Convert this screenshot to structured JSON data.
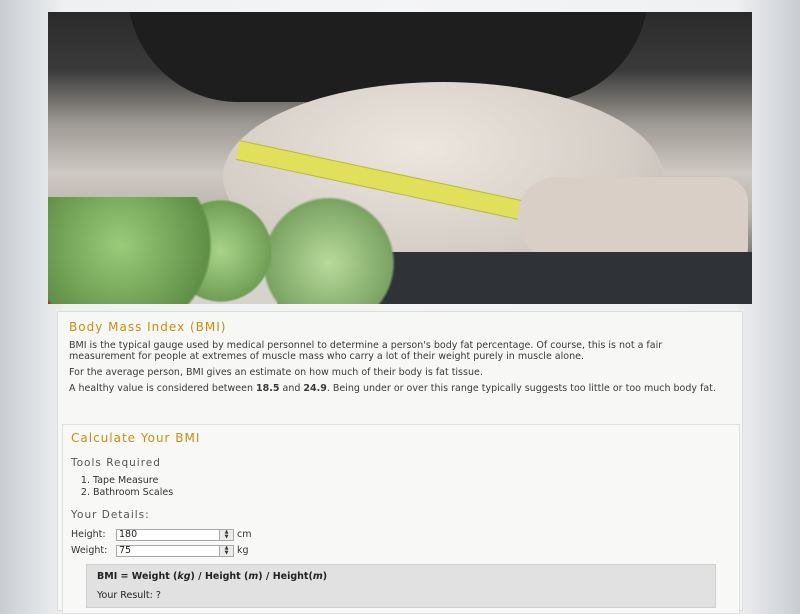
{
  "bmi": {
    "title": "Body Mass Index (BMI)",
    "para1": "BMI is the typical gauge used by medical personnel to determine a person's body fat percentage.  Of course, this is not a fair measurement for people at extremes of muscle mass who carry a lot of their weight purely in muscle alone.",
    "para2": "For the average person, BMI gives an estimate on how much of their body is fat tissue.",
    "para3_before": "A healthy value is considered between ",
    "para3_low": "18.5",
    "para3_mid": " and ",
    "para3_high": "24.9",
    "para3_after": ".  Being under or over this range typically suggests too little or too much body fat."
  },
  "calculator": {
    "title": "Calculate Your BMI",
    "tools_heading": "Tools Required",
    "tools": [
      "Tape Measure",
      "Bathroom Scales"
    ],
    "details_heading": "Your Details:",
    "height_label": "Height:",
    "height_value": "180",
    "height_unit": "cm",
    "weight_label": "Weight:",
    "weight_value": "75",
    "weight_unit": "kg",
    "formula_prefix": "BMI = Weight (",
    "formula_kg": "kg",
    "formula_mid1": ") / Height (",
    "formula_m1": "m",
    "formula_mid2": ") / Height(",
    "formula_m2": "m",
    "formula_suffix": ")",
    "result_text": "Your Result: ?"
  },
  "colors": {
    "heading": "#c98f0c",
    "tape": "#e0e05a"
  }
}
